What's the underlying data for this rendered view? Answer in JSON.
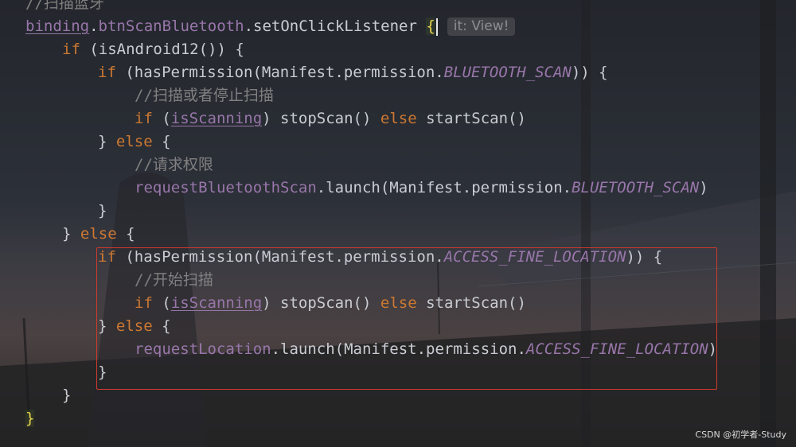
{
  "editor": {
    "lines": [
      {
        "comment": "//扫描蓝牙"
      },
      {
        "binding": "binding",
        "dot": ".",
        "field": "btnScanBluetooth",
        "call": ".setOnClickListener ",
        "brace": "{",
        "hint": "it: View!"
      },
      {
        "kw_if": "if",
        "rest": " (isAndroid12()) {"
      },
      {
        "kw_if": "if",
        "a": " (hasPermission(Manifest.permission.",
        "const": "BLUETOOTH_SCAN",
        "b": ")) {"
      },
      {
        "comment": "//扫描或者停止扫描"
      },
      {
        "kw_if": "if",
        "a": " (",
        "var": "isScanning",
        "b": ") stopScan() ",
        "kw_else": "else",
        "c": " startScan()"
      },
      {
        "a": "} ",
        "kw_else": "else",
        "b": " {"
      },
      {
        "comment": "//请求权限"
      },
      {
        "field": "requestBluetoothScan",
        "a": ".launch(Manifest.permission.",
        "const": "BLUETOOTH_SCAN",
        "b": ")"
      },
      {
        "a": "}"
      },
      {
        "a": "} ",
        "kw_else": "else",
        "b": " {"
      },
      {
        "kw_if": "if",
        "a": " (hasPermission(Manifest.permission.",
        "const": "ACCESS_FINE_LOCATION",
        "b": ")) {"
      },
      {
        "comment": "//开始扫描"
      },
      {
        "kw_if": "if",
        "a": " (",
        "var": "isScanning",
        "b": ") stopScan() ",
        "kw_else": "else",
        "c": " startScan()"
      },
      {
        "a": "} ",
        "kw_else": "else",
        "b": " {"
      },
      {
        "field": "requestLocation",
        "a": ".launch(Manifest.permission.",
        "const": "ACCESS_FINE_LOCATION",
        "b": ")"
      },
      {
        "a": "}"
      },
      {
        "a": "}"
      },
      {
        "brace": "}"
      }
    ]
  },
  "watermark": "CSDN @初学者-Study",
  "colors": {
    "keyword": "#cc7832",
    "comment": "#808080",
    "field": "#9876aa",
    "text": "#c9ccd2",
    "highlight_box": "#d03a2e",
    "brace_highlight": "#e8d34d"
  }
}
